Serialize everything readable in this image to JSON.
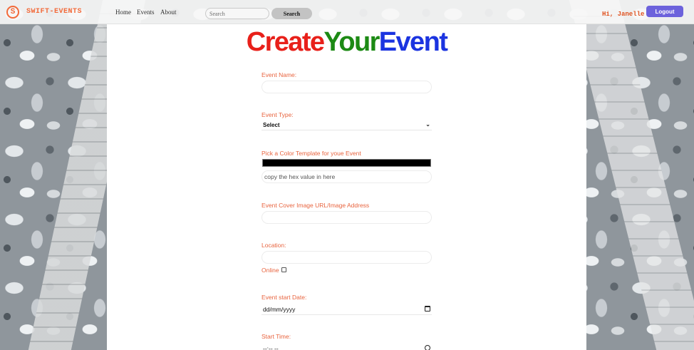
{
  "nav": {
    "logo_letter": "S",
    "brand": "SWIFT-EVENTS",
    "links": [
      "Home",
      "Events",
      "About"
    ],
    "search_placeholder": "Search",
    "search_button": "Search",
    "greeting": "Hi, Janelle",
    "logout": "Logout"
  },
  "form": {
    "title_parts": [
      "Create",
      "Your",
      "Event"
    ],
    "event_name_label": "Event Name:",
    "event_type_label": "Event Type:",
    "event_type_selected": "Select",
    "color_label": "Pick a Color Template for youe Event",
    "color_value": "#000000",
    "hex_placeholder": "copy the hex value in here",
    "cover_label": "Event Cover Image URL/Image Address",
    "location_label": "Location:",
    "online_label": "Online",
    "online_checked": false,
    "start_date_label": "Event start Date:",
    "start_date_placeholder": "dd/mm/yyyy",
    "start_time_label": "Start Time:",
    "start_time_placeholder": "--:-- --"
  },
  "colors": {
    "brand_orange": "#f26a3a",
    "label_orange": "#e8643f",
    "logout_purple": "#6c62dc",
    "title_red": "#e8201a",
    "title_green": "#1c8a14",
    "title_blue": "#1b34e0"
  }
}
